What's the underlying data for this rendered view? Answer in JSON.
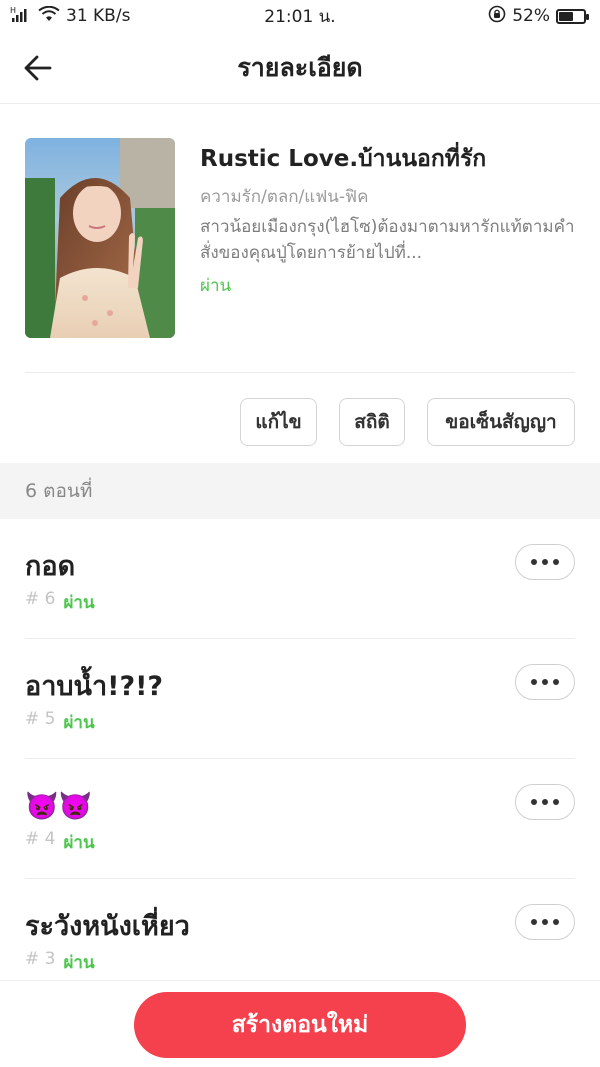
{
  "status_bar": {
    "signal_text": "H",
    "speed": "31 KB/s",
    "time": "21:01 น.",
    "battery": "52%",
    "battery_level": 0.52
  },
  "header": {
    "title": "รายละเอียด"
  },
  "book": {
    "title": "Rustic Love.บ้านนอกที่รัก",
    "genre": "ความรัก/ตลก/แฟน-ฟิค",
    "description": "สาวน้อยเมืองกรุง(ไฮโซ)ต้องมาตามหารักแท้ตามคำสั่งของคุณปู่โดยการย้ายไปที่...",
    "status": "ผ่าน"
  },
  "actions": {
    "edit": "แก้ไข",
    "stats": "สถิติ",
    "contract": "ขอเซ็นสัญญา"
  },
  "section": {
    "episodes_count": "6 ตอนที่"
  },
  "episodes": [
    {
      "title": "กอด",
      "number": "# 6",
      "status": "ผ่าน"
    },
    {
      "title": "อาบน้ำ!?!?",
      "number": "# 5",
      "status": "ผ่าน"
    },
    {
      "title": "👿👿",
      "number": "# 4",
      "status": "ผ่าน"
    },
    {
      "title": "ระวังหนังเหี่ยว",
      "number": "# 3",
      "status": "ผ่าน"
    }
  ],
  "footer": {
    "create_label": "สร้างตอนใหม่"
  },
  "colors": {
    "accent": "#f5404d",
    "status_green": "#4cc64c"
  }
}
